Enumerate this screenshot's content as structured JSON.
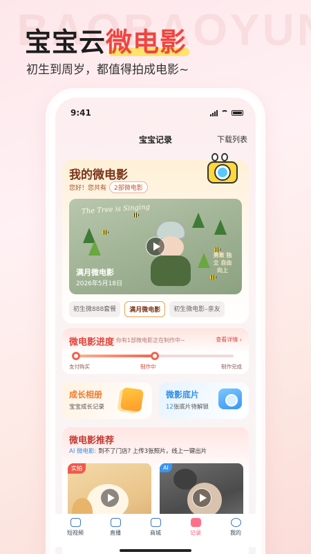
{
  "promo": {
    "title_part1": "宝宝云",
    "title_part2": "微电影",
    "subtitle": "初生到周岁，都值得拍成电影~",
    "bg_word": "BAOBAOYUN"
  },
  "status_bar": {
    "time": "9:41"
  },
  "nav": {
    "title": "宝宝记录",
    "right_link": "下载列表"
  },
  "my_movie": {
    "title": "我的微电影",
    "greeting": "您好！您共有",
    "count_pill": "2部微电影",
    "video": {
      "banner_text": "The Tree is Singing",
      "title": "满月微电影",
      "date": "2026年5月18日",
      "side_text": "勇敢 独立 自由 向上"
    },
    "packages": [
      {
        "label": "初生微888套餐",
        "active": false
      },
      {
        "label": "满月微电影",
        "active": true
      },
      {
        "label": "初生微电影–亲友",
        "active": false
      }
    ]
  },
  "progress": {
    "title": "微电影进度",
    "hint": "你有1部微电影正在制作中~",
    "detail_link": "查看详情 ›",
    "value": 0.5,
    "steps": [
      "支付购买",
      "制作中",
      "制作完成"
    ],
    "current_step": 1
  },
  "growth_album": {
    "title": "成长相册",
    "subtitle": "宝宝成长记录"
  },
  "film_negatives": {
    "title": "微影底片",
    "count": "12",
    "subtitle_suffix": "张底片待解锁"
  },
  "recommend": {
    "title": "微电影推荐",
    "ai_label": "AI 微电影:",
    "desc": "到不了门店? 上传3张照片，线上一键出片",
    "items": [
      {
        "badge": "实拍"
      },
      {
        "badge": "AI"
      }
    ]
  },
  "tabbar": [
    {
      "label": "短视频",
      "icon": "tv-icon",
      "active": false
    },
    {
      "label": "直播",
      "icon": "live-icon",
      "active": false
    },
    {
      "label": "商城",
      "icon": "shop-icon",
      "active": false
    },
    {
      "label": "记录",
      "icon": "record-icon",
      "active": true
    },
    {
      "label": "我的",
      "icon": "profile-icon",
      "active": false
    }
  ],
  "colors": {
    "accent_red": "#f0453f",
    "highlight_yellow": "#ffe36b",
    "brand_orange": "#f07a2a",
    "link_blue": "#2f8fe6",
    "active_tab_pink": "#ff5a78"
  }
}
